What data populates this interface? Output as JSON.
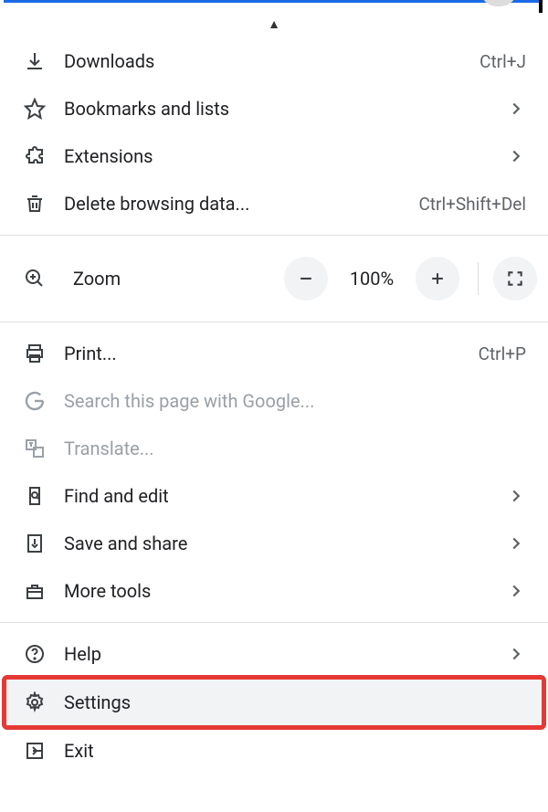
{
  "menu": {
    "downloads_label": "Downloads",
    "downloads_shortcut": "Ctrl+J",
    "bookmarks_label": "Bookmarks and lists",
    "extensions_label": "Extensions",
    "delete_label": "Delete browsing data...",
    "delete_shortcut": "Ctrl+Shift+Del",
    "zoom_label": "Zoom",
    "zoom_value": "100%",
    "print_label": "Print...",
    "print_shortcut": "Ctrl+P",
    "search_page_label": "Search this page with Google...",
    "translate_label": "Translate...",
    "find_edit_label": "Find and edit",
    "save_share_label": "Save and share",
    "more_tools_label": "More tools",
    "help_label": "Help",
    "settings_label": "Settings",
    "exit_label": "Exit"
  }
}
